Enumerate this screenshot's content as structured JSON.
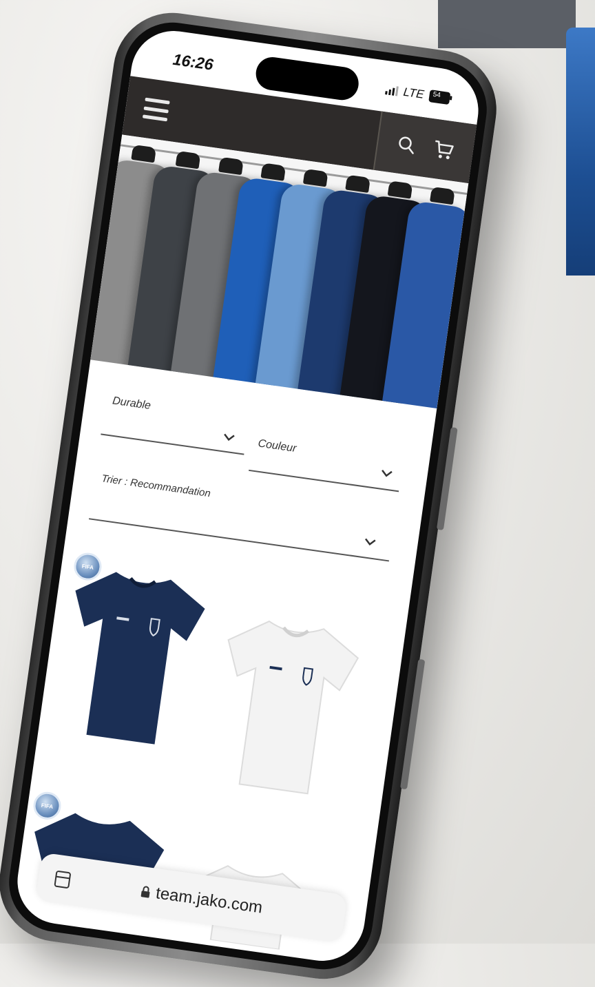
{
  "status_bar": {
    "time": "16:26",
    "network": "LTE",
    "battery": "54"
  },
  "header": {
    "menu_icon": "hamburger-menu-icon",
    "search_icon": "search-icon",
    "cart_icon": "cart-icon"
  },
  "hero": {
    "shirt_colors": [
      "#8c8c8c",
      "#3e4247",
      "#6f7174",
      "#1f5fb8",
      "#6a9ad0",
      "#1d3a6e",
      "#14161d",
      "#2a58a6"
    ]
  },
  "filters": {
    "durable_label": "Durable",
    "color_label": "Couleur",
    "sort_label": "Trier : Recommandation"
  },
  "products": {
    "items": [
      {
        "color": "#1b2f55",
        "badge": "FIFA"
      },
      {
        "color": "#f3f3f3",
        "badge": ""
      },
      {
        "color": "#1b2f55",
        "badge": "FIFA"
      },
      {
        "color": "#f3f3f3",
        "badge": ""
      }
    ]
  },
  "browser": {
    "url": "team.jako.com",
    "tabs_icon": "tabs-icon",
    "lock_icon": "lock-icon"
  },
  "colors": {
    "topbar": "#2e2b2a",
    "accent_blue": "#1f5fb8",
    "navy": "#1b2f55"
  }
}
